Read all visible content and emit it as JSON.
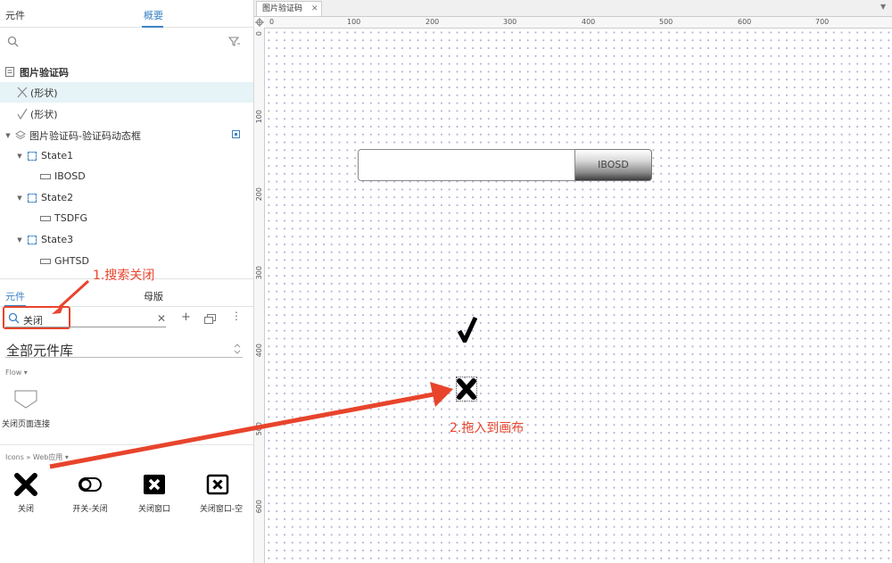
{
  "top_tabs": {
    "widgets": "元件",
    "outline": "概要"
  },
  "outline": {
    "search_placeholder": "",
    "page_name": "图片验证码",
    "items": [
      {
        "label": "(形状)"
      },
      {
        "label": "(形状)"
      },
      {
        "label": "图片验证码-验证码动态框"
      },
      {
        "label": "State1"
      },
      {
        "label": "IBOSD"
      },
      {
        "label": "State2"
      },
      {
        "label": "TSDFG"
      },
      {
        "label": "State3"
      },
      {
        "label": "GHTSD"
      }
    ]
  },
  "bottom_tabs": {
    "widgets": "元件",
    "masters": "母版"
  },
  "library": {
    "search_value": "关闭",
    "library_name": "全部元件库",
    "flow_group": "Flow ▾",
    "flow_item": "关闭页面连接",
    "icons_group": "Icons » Web应用 ▾",
    "icons": [
      {
        "label": "关闭"
      },
      {
        "label": "开关-关闭"
      },
      {
        "label": "关闭窗口"
      },
      {
        "label": "关闭窗口-空"
      }
    ]
  },
  "annotations": {
    "step1": "1.搜索关闭",
    "step2": "2.拖入到画布"
  },
  "canvas": {
    "doc_tab": "图片验证码",
    "ruler_h": [
      "0",
      "100",
      "200",
      "300",
      "400",
      "500",
      "600",
      "700"
    ],
    "ruler_v": [
      "0",
      "100",
      "200",
      "300",
      "400",
      "500",
      "600"
    ],
    "captcha_button": "IBOSD"
  },
  "colors": {
    "accent": "#3b82c4",
    "annotation": "#e8442c",
    "selected_row": "#e6f3f7"
  }
}
